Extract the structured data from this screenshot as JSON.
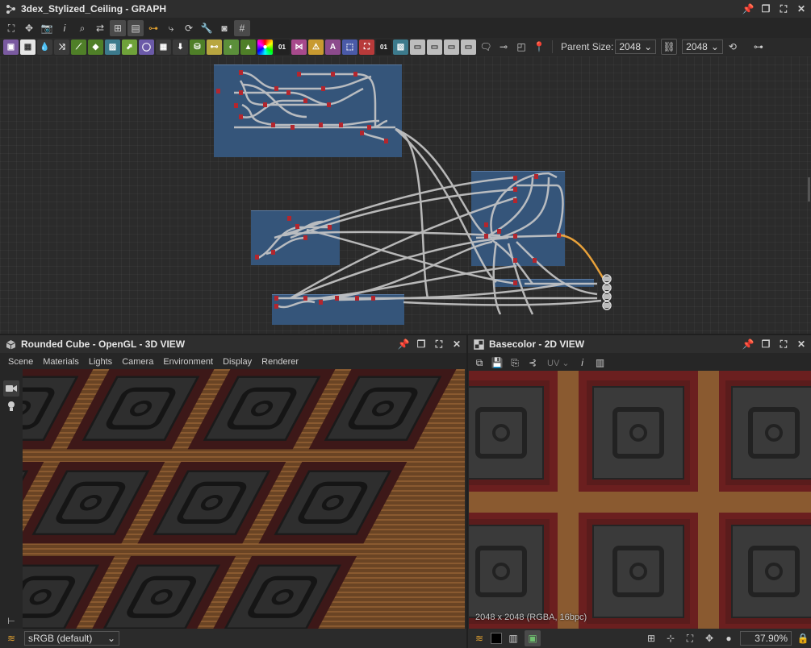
{
  "graph": {
    "title": "3dex_Stylized_Ceiling - GRAPH",
    "parent_size_label": "Parent Size:",
    "parent_size_value": "2048",
    "output_size_value": "2048",
    "node_labels": {
      "n1": "01",
      "n2": "01"
    }
  },
  "view3d": {
    "title": "Rounded Cube - OpenGL - 3D VIEW",
    "menu": [
      "Scene",
      "Materials",
      "Lights",
      "Camera",
      "Environment",
      "Display",
      "Renderer"
    ],
    "colorspace": "sRGB (default)"
  },
  "view2d": {
    "title": "Basecolor - 2D VIEW",
    "uv_label": "UV",
    "resolution_info": "2048 x 2048 (RGBA, 16bpc)",
    "zoom": "37.90%"
  },
  "colors": {
    "frame_blue": "#35557a",
    "wire": "#c8c8c8",
    "wire_highlight": "#e8a13a",
    "node_red": "#b3262e",
    "accent_green": "#4f7f28",
    "accent_purple": "#6b5aa8"
  }
}
